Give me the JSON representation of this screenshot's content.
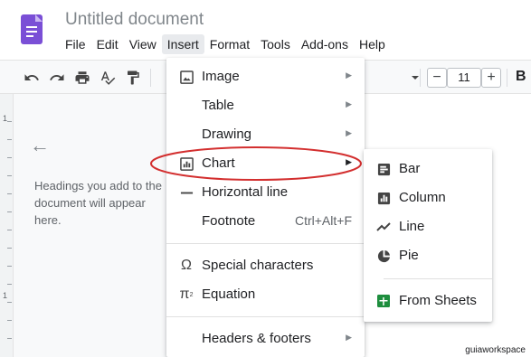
{
  "document": {
    "title": "Untitled document"
  },
  "menubar": {
    "items": [
      {
        "label": "File"
      },
      {
        "label": "Edit"
      },
      {
        "label": "View"
      },
      {
        "label": "Insert"
      },
      {
        "label": "Format"
      },
      {
        "label": "Tools"
      },
      {
        "label": "Add-ons"
      },
      {
        "label": "Help"
      }
    ],
    "active": "Insert"
  },
  "toolbar": {
    "font_size": "11",
    "decrease_label": "−",
    "increase_label": "+",
    "bold_label": "B",
    "icons": [
      "undo-icon",
      "redo-icon",
      "print-icon",
      "spellcheck-icon",
      "paint-format-icon",
      "dropdown-caret-icon"
    ]
  },
  "outline": {
    "hint": "Headings you add to the document will appear here."
  },
  "insert_menu": {
    "items": [
      {
        "label": "Image",
        "icon": "image-icon",
        "submenu": true
      },
      {
        "label": "Table",
        "submenu": true
      },
      {
        "label": "Drawing",
        "submenu": true
      },
      {
        "label": "Chart",
        "icon": "chart-icon",
        "submenu": true,
        "highlighted": true
      },
      {
        "label": "Horizontal line",
        "icon": "horizontal-line-icon"
      },
      {
        "label": "Footnote",
        "shortcut": "Ctrl+Alt+F"
      },
      {
        "label": "Special characters",
        "icon": "omega-icon"
      },
      {
        "label": "Equation",
        "icon": "pi-icon"
      },
      {
        "label": "Headers & footers",
        "submenu": true
      }
    ]
  },
  "chart_submenu": {
    "items": [
      {
        "label": "Bar",
        "icon": "bar-chart-icon"
      },
      {
        "label": "Column",
        "icon": "column-chart-icon"
      },
      {
        "label": "Line",
        "icon": "line-chart-icon"
      },
      {
        "label": "Pie",
        "icon": "pie-chart-icon"
      },
      {
        "label": "From Sheets",
        "icon": "sheets-icon"
      }
    ]
  },
  "colors": {
    "docs_brand": "#7a4fd6",
    "sheets_brand": "#1e8e3e",
    "highlight_ellipse": "#d32f2f"
  },
  "watermark": "guiaworkspace"
}
